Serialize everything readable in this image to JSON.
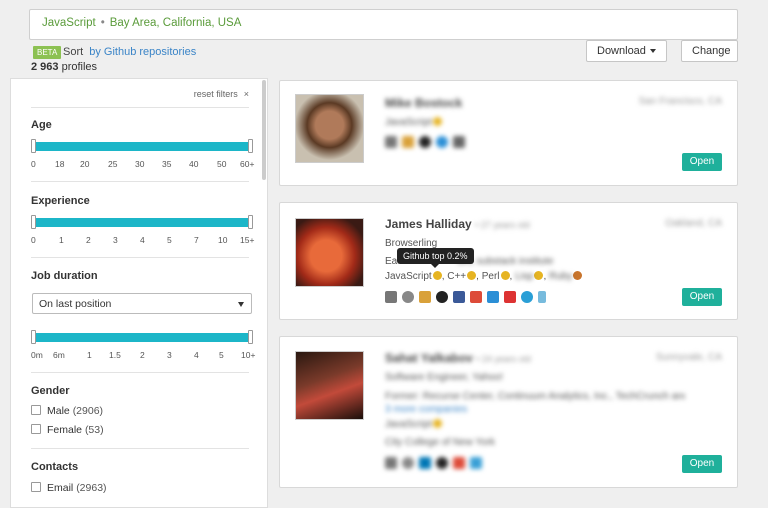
{
  "search": {
    "skill": "JavaScript",
    "separator": "•",
    "location": "Bay Area, California, USA"
  },
  "sort": {
    "badge": "BETA",
    "label": "Sort",
    "by": "by Github repositories"
  },
  "profiles": {
    "count": "2 963",
    "label": "profiles"
  },
  "toolbar": {
    "download": "Download",
    "change": "Change"
  },
  "filters": {
    "reset": "reset filters",
    "reset_icon": "×",
    "age": {
      "title": "Age",
      "ticks": [
        "0",
        "18",
        "20",
        "25",
        "30",
        "35",
        "40",
        "50",
        "60+"
      ]
    },
    "experience": {
      "title": "Experience",
      "ticks": [
        "0",
        "1",
        "2",
        "3",
        "4",
        "5",
        "7",
        "10",
        "15+"
      ]
    },
    "job_duration": {
      "title": "Job duration",
      "select": "On last position",
      "ticks": [
        "0m",
        "6m",
        "1",
        "1.5",
        "2",
        "3",
        "4",
        "5",
        "10+"
      ]
    },
    "gender": {
      "title": "Gender",
      "options": [
        {
          "label": "Male",
          "count": "(2906)"
        },
        {
          "label": "Female",
          "count": "(53)"
        }
      ]
    },
    "contacts": {
      "title": "Contacts",
      "options": [
        {
          "label": "Email",
          "count": "(2963)"
        }
      ]
    }
  },
  "cards": [
    {
      "name": "Mike Bostock",
      "location": "San Francisco, CA",
      "skills": "JavaScript",
      "open": "Open"
    },
    {
      "name": "James Halliday",
      "age": "• 27 years old",
      "location": "Oakland, CA",
      "line1": "Browserling",
      "line2": "Ea",
      "line2b": "om, substack institute",
      "skills": [
        "JavaScript",
        "C++",
        "Perl",
        "Lisp",
        "Ruby"
      ],
      "open": "Open",
      "tooltip": "Github top 0.2%"
    },
    {
      "name": "Sahat Yalkabov",
      "age": "• 24 years old",
      "location": "Sunnyvale, CA",
      "line1": "Software Engineer, Yahoo!",
      "line2": "Former: Recurse Center, Continuum Analytics, Inc., TechCrunch and",
      "line3": "3 more companies",
      "skills": "JavaScript",
      "school": "City College of New York",
      "open": "Open"
    }
  ]
}
